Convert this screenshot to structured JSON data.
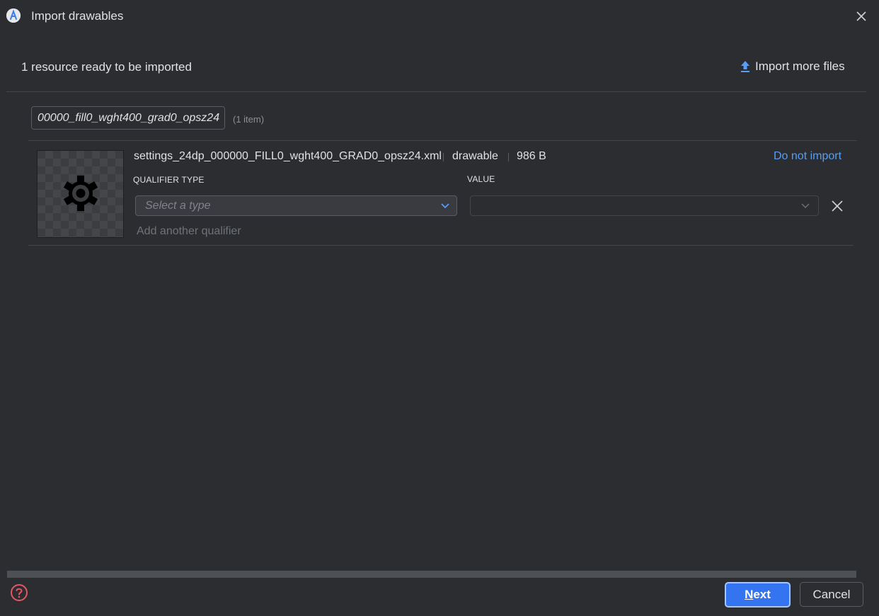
{
  "window": {
    "title": "Import drawables",
    "app_icon": "android-studio-icon",
    "close_icon": "close-icon"
  },
  "header": {
    "summary": "1 resource ready to be imported",
    "import_more_label": "Import more files",
    "import_more_icon": "upload-icon"
  },
  "group": {
    "folder_name": "00000_fill0_wght400_grad0_opsz24",
    "item_count": "(1 item)"
  },
  "resource": {
    "preview_icon": "settings-gear-icon",
    "file_name": "settings_24dp_000000_FILL0_wght400_GRAD0_opsz24.xml",
    "type": "drawable",
    "size": "986 B",
    "do_not_import_label": "Do not import",
    "qualifier_type_label": "QUALIFIER TYPE",
    "value_label": "VALUE",
    "qualifier_type_placeholder": "Select a type",
    "value_selected": "",
    "add_qualifier_label": "Add another qualifier"
  },
  "footer": {
    "help_icon": "help-icon",
    "next_mnemonic": "N",
    "next_rest": "ext",
    "cancel_label": "Cancel"
  },
  "colors": {
    "background": "#2b2d30",
    "text": "#dfe1e5",
    "link": "#589df6",
    "primary_button": "#3574f0",
    "help_icon": "#e55765",
    "muted_text": "#6f7277"
  }
}
